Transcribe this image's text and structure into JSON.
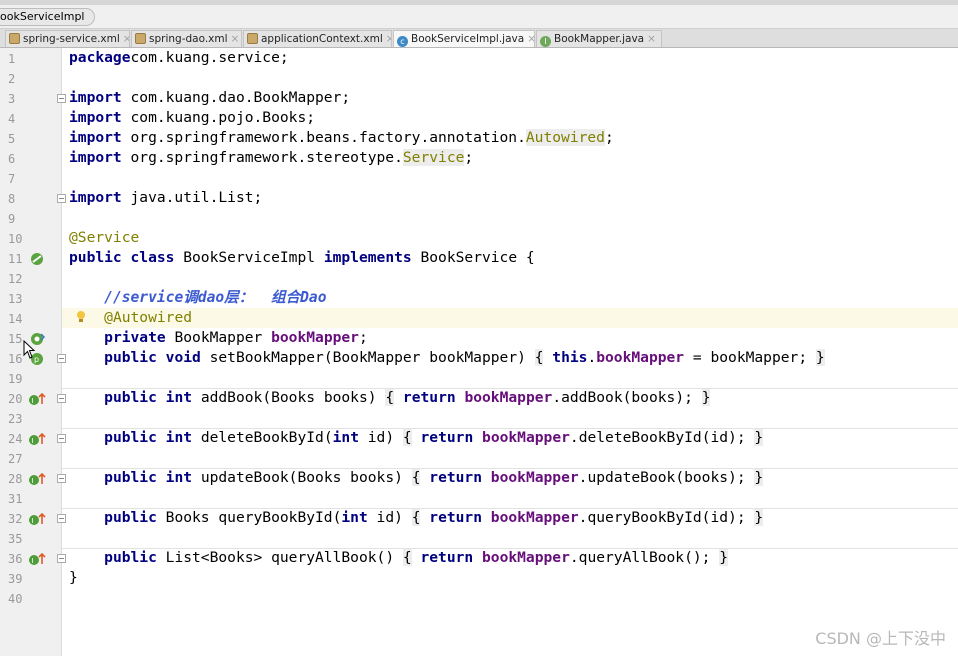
{
  "breadcrumb": {
    "label": "ookServiceImpl"
  },
  "tabs": [
    {
      "label": "spring-service.xml",
      "icon": "xml-file-icon",
      "active": false
    },
    {
      "label": "spring-dao.xml",
      "icon": "xml-file-icon",
      "active": false
    },
    {
      "label": "applicationContext.xml",
      "icon": "xml-file-icon",
      "active": false
    },
    {
      "label": "BookServiceImpl.java",
      "icon": "java-class-icon",
      "active": true
    },
    {
      "label": "BookMapper.java",
      "icon": "java-interface-icon",
      "active": false
    }
  ],
  "tab_close": "×",
  "class_icon_letter": "c",
  "interface_icon_letter": "I",
  "lines": [
    {
      "n": "1",
      "parts": [
        [
          "kw",
          "package"
        ],
        [
          "",
          "com.kuang.service;"
        ]
      ]
    },
    {
      "n": "2",
      "parts": []
    },
    {
      "n": "3",
      "parts": [
        [
          "kw",
          "import"
        ],
        [
          "",
          " com.kuang.dao.BookMapper;"
        ]
      ]
    },
    {
      "n": "4",
      "parts": [
        [
          "kw",
          "import"
        ],
        [
          "",
          " com.kuang.pojo.Books;"
        ]
      ]
    },
    {
      "n": "5",
      "parts": [
        [
          "kw",
          "import"
        ],
        [
          "",
          " org.springframework.beans.factory.annotation."
        ],
        [
          "annref",
          "Autowired"
        ],
        [
          "",
          ";"
        ]
      ]
    },
    {
      "n": "6",
      "parts": [
        [
          "kw",
          "import"
        ],
        [
          "",
          " org.springframework.stereotype."
        ],
        [
          "annref",
          "Service"
        ],
        [
          "",
          ";"
        ]
      ]
    },
    {
      "n": "7",
      "parts": []
    },
    {
      "n": "8",
      "parts": [
        [
          "kw",
          "import"
        ],
        [
          "",
          " java.util.List;"
        ]
      ]
    },
    {
      "n": "9",
      "parts": []
    },
    {
      "n": "10",
      "parts": [
        [
          "ann",
          "@Service"
        ]
      ]
    },
    {
      "n": "11",
      "parts": [
        [
          "kw",
          "public class"
        ],
        [
          "",
          " BookServiceImpl "
        ],
        [
          "kw",
          "implements"
        ],
        [
          "",
          " BookService {"
        ]
      ]
    },
    {
      "n": "12",
      "parts": []
    },
    {
      "n": "13",
      "parts": [
        [
          "",
          "    "
        ],
        [
          "cm",
          "//service调dao层：  组合Dao"
        ]
      ]
    },
    {
      "n": "14",
      "parts": [
        [
          "",
          "    "
        ],
        [
          "ann",
          "@Autowired"
        ]
      ]
    },
    {
      "n": "15",
      "parts": [
        [
          "",
          "    "
        ],
        [
          "kw",
          "private"
        ],
        [
          "",
          " BookMapper "
        ],
        [
          "fld",
          "bookMapper"
        ],
        [
          "",
          ";"
        ]
      ]
    },
    {
      "n": "16",
      "parts": [
        [
          "",
          "    "
        ],
        [
          "kw",
          "public void"
        ],
        [
          "",
          " setBookMapper(BookMapper bookMapper) "
        ],
        [
          "brace",
          "{"
        ],
        [
          "",
          " "
        ],
        [
          "kw",
          "this"
        ],
        [
          "",
          "."
        ],
        [
          "fld",
          "bookMapper"
        ],
        [
          "",
          " = bookMapper; "
        ],
        [
          "brace",
          "}"
        ]
      ]
    },
    {
      "n": "19",
      "parts": []
    },
    {
      "n": "20",
      "parts": [
        [
          "",
          "    "
        ],
        [
          "kw",
          "public int"
        ],
        [
          "",
          " addBook(Books books) "
        ],
        [
          "brace",
          "{"
        ],
        [
          "",
          " "
        ],
        [
          "kw",
          "return"
        ],
        [
          "",
          " "
        ],
        [
          "fld",
          "bookMapper"
        ],
        [
          "",
          ".addBook(books); "
        ],
        [
          "brace",
          "}"
        ]
      ]
    },
    {
      "n": "23",
      "parts": []
    },
    {
      "n": "24",
      "parts": [
        [
          "",
          "    "
        ],
        [
          "kw",
          "public int"
        ],
        [
          "",
          " deleteBookById("
        ],
        [
          "kw",
          "int"
        ],
        [
          "",
          " id) "
        ],
        [
          "brace",
          "{"
        ],
        [
          "",
          " "
        ],
        [
          "kw",
          "return"
        ],
        [
          "",
          " "
        ],
        [
          "fld",
          "bookMapper"
        ],
        [
          "",
          ".deleteBookById(id); "
        ],
        [
          "brace",
          "}"
        ]
      ]
    },
    {
      "n": "27",
      "parts": []
    },
    {
      "n": "28",
      "parts": [
        [
          "",
          "    "
        ],
        [
          "kw",
          "public int"
        ],
        [
          "",
          " updateBook(Books books) "
        ],
        [
          "brace",
          "{"
        ],
        [
          "",
          " "
        ],
        [
          "kw",
          "return"
        ],
        [
          "",
          " "
        ],
        [
          "fld",
          "bookMapper"
        ],
        [
          "",
          ".updateBook(books); "
        ],
        [
          "brace",
          "}"
        ]
      ]
    },
    {
      "n": "31",
      "parts": []
    },
    {
      "n": "32",
      "parts": [
        [
          "",
          "    "
        ],
        [
          "kw",
          "public"
        ],
        [
          "",
          " Books queryBookById("
        ],
        [
          "kw",
          "int"
        ],
        [
          "",
          " id) "
        ],
        [
          "brace",
          "{"
        ],
        [
          "",
          " "
        ],
        [
          "kw",
          "return"
        ],
        [
          "",
          " "
        ],
        [
          "fld",
          "bookMapper"
        ],
        [
          "",
          ".queryBookById(id); "
        ],
        [
          "brace",
          "}"
        ]
      ]
    },
    {
      "n": "35",
      "parts": []
    },
    {
      "n": "36",
      "parts": [
        [
          "",
          "    "
        ],
        [
          "kw",
          "public"
        ],
        [
          "",
          " List<Books> queryAllBook() "
        ],
        [
          "brace",
          "{"
        ],
        [
          "",
          " "
        ],
        [
          "kw",
          "return"
        ],
        [
          "",
          " "
        ],
        [
          "fld",
          "bookMapper"
        ],
        [
          "",
          ".queryAllBook(); "
        ],
        [
          "brace",
          "}"
        ]
      ]
    },
    {
      "n": "39",
      "parts": [
        [
          "",
          "}"
        ]
      ]
    },
    {
      "n": "40",
      "parts": []
    }
  ],
  "highlighted_line": "14",
  "colors": {
    "keyword": "#000080",
    "annotation": "#808000",
    "field": "#660e7a",
    "comment": "#3c5ad0",
    "line_highlight": "#fcfae6"
  },
  "watermark": "CSDN @上下没中"
}
